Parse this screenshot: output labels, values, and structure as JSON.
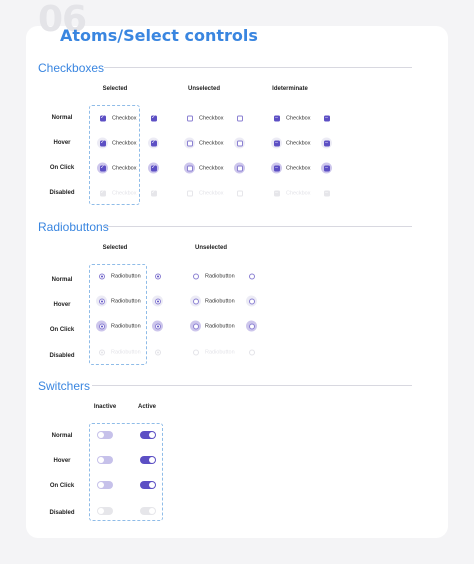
{
  "page": {
    "number": "06",
    "title": "Atoms/Select controls"
  },
  "checkboxes": {
    "heading": "Checkboxes",
    "columns": [
      "Selected",
      "Unselected",
      "Ideterminate"
    ],
    "rows": [
      "Normal",
      "Hover",
      "On Click",
      "Disabled"
    ],
    "label": "Checkbox"
  },
  "radiobuttons": {
    "heading": "Radiobuttons",
    "columns": [
      "Selected",
      "Unselected"
    ],
    "rows": [
      "Normal",
      "Hover",
      "On Click",
      "Disabled"
    ],
    "label": "Radiobutton"
  },
  "switchers": {
    "heading": "Switchers",
    "columns": [
      "Inactive",
      "Active"
    ],
    "rows": [
      "Normal",
      "Hover",
      "On Click",
      "Disabled"
    ]
  },
  "colors": {
    "accent": "#3a86e0",
    "primary": "#5c4fc4",
    "inactive_track": "#c6c1ea",
    "disabled": "#e6e6ea"
  }
}
